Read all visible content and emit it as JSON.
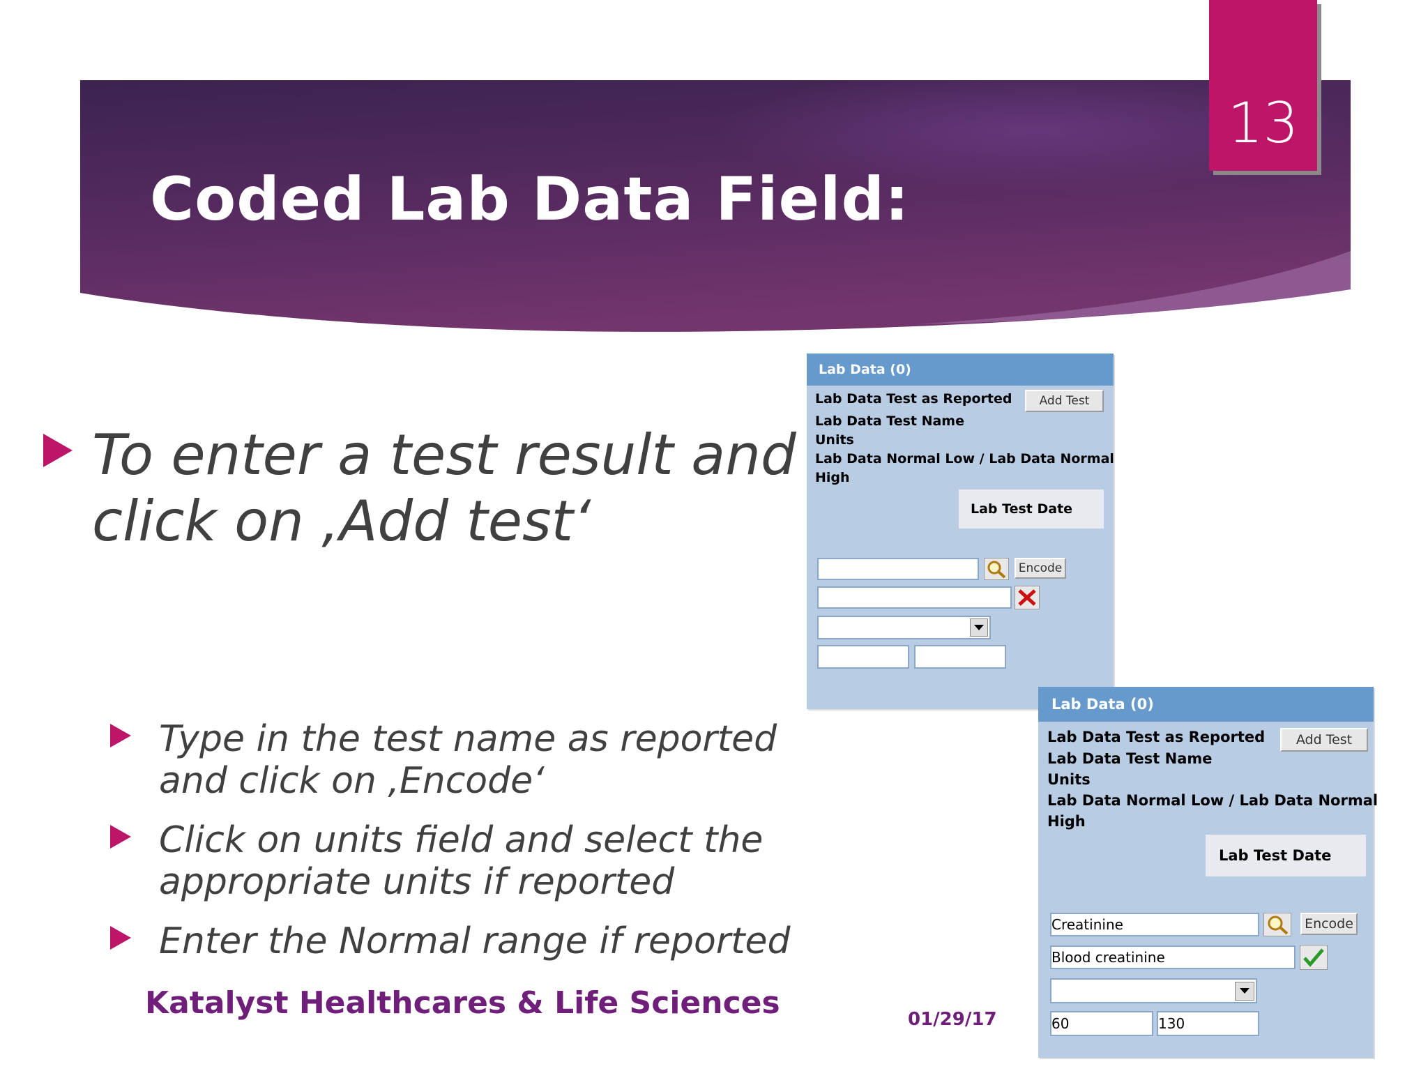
{
  "slide": {
    "title": "Coded Lab Data Field:",
    "number": "13",
    "main_bullet": [
      "To enter a test result and",
      "click on ‚Add test‘"
    ],
    "sub_bullets": [
      [
        "Type in the test name as reported",
        "and click on ‚Encode‘"
      ],
      [
        "Click on units field and select the",
        "appropriate units if reported"
      ],
      [
        "Enter the Normal range if reported"
      ]
    ],
    "footer_org": "Katalyst Healthcares & Life Sciences",
    "footer_date": "01/29/17"
  },
  "panel_empty": {
    "header": "Lab Data (0)",
    "label_reported": "Lab Data Test as Reported",
    "add_test_label": "Add Test",
    "label_test_name": "Lab Data Test Name",
    "label_units": "Units",
    "label_normal_1": "Lab Data Normal Low / Lab Data Normal",
    "label_normal_2": "High",
    "lab_test_date": "Lab Test Date",
    "encode_label": "Encode",
    "reported_value": "",
    "test_name_value": "",
    "low_value": "",
    "high_value": ""
  },
  "panel_filled": {
    "header": "Lab Data (0)",
    "label_reported": "Lab Data Test as Reported",
    "add_test_label": "Add Test",
    "label_test_name": "Lab Data Test Name",
    "label_units": "Units",
    "label_normal_1": "Lab Data Normal Low / Lab Data Normal",
    "label_normal_2": "High",
    "lab_test_date": "Lab Test Date",
    "encode_label": "Encode",
    "reported_value": "Creatinine",
    "test_name_value": "Blood creatinine",
    "low_value": "60",
    "high_value": "130"
  },
  "colors": {
    "accent": "#bd1567",
    "banner_dark": "#3b2350",
    "banner_light": "#70346a",
    "panel_bg": "#b8cce4",
    "panel_header": "#6699cc",
    "footer_text": "#6f1f7a"
  },
  "icons": [
    "magnifier-icon",
    "red-x-icon",
    "green-check-icon",
    "dropdown-arrow-icon",
    "bullet-triangle-icon"
  ]
}
